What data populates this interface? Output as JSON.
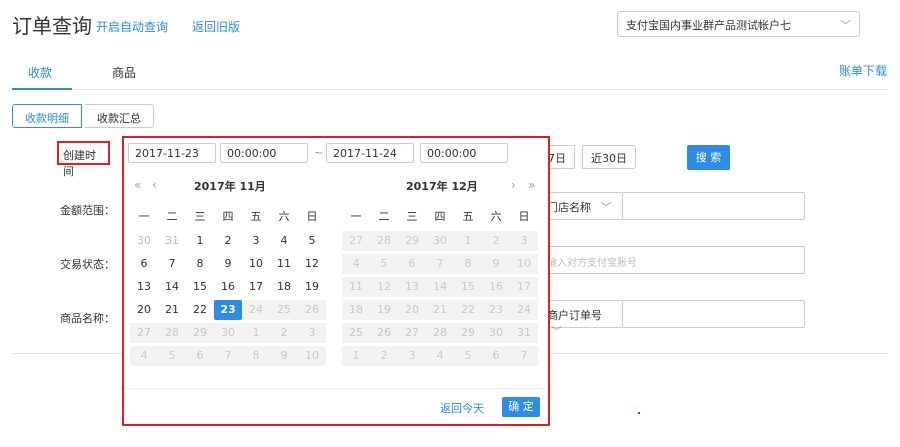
{
  "header": {
    "title": "订单查询",
    "auto_query": "开启自动查询",
    "old_version": "返回旧版",
    "account": "支付宝国内事业群产品测试帐户七"
  },
  "tabs": {
    "receipts": "收款",
    "goods": "商品",
    "bill_download": "账单下载"
  },
  "subtabs": {
    "detail": "收款明细",
    "summary": "收款汇总"
  },
  "form": {
    "created_time": "创建时间",
    "amount_range": "金额范围：",
    "trade_status": "交易状态：",
    "goods_name": "商品名称：",
    "quick_7": "7日",
    "quick_30": "近30日",
    "search": "搜 索",
    "store_name": "门店名称",
    "counterparty_placeholder": "输入对方支付宝账号",
    "merchant_order": "商户订单号"
  },
  "picker": {
    "start_date": "2017-11-23",
    "start_time": "00:00:00",
    "tilde": "~",
    "end_date": "2017-11-24",
    "end_time": "00:00:00",
    "nav_prev_year": "«",
    "nav_prev_month": "‹",
    "nav_next_month": "›",
    "nav_next_year": "»",
    "left_title": "2017年 11月",
    "right_title": "2017年 12月",
    "weekdays": [
      "一",
      "二",
      "三",
      "四",
      "五",
      "六",
      "日"
    ],
    "left_days": [
      [
        "30",
        "31",
        "1",
        "2",
        "3",
        "4",
        "5"
      ],
      [
        "6",
        "7",
        "8",
        "9",
        "10",
        "11",
        "12"
      ],
      [
        "13",
        "14",
        "15",
        "16",
        "17",
        "18",
        "19"
      ],
      [
        "20",
        "21",
        "22",
        "23",
        "24",
        "25",
        "26"
      ],
      [
        "27",
        "28",
        "29",
        "30",
        "1",
        "2",
        "3"
      ],
      [
        "4",
        "5",
        "6",
        "7",
        "8",
        "9",
        "10"
      ]
    ],
    "right_days": [
      [
        "27",
        "28",
        "29",
        "30",
        "1",
        "2",
        "3"
      ],
      [
        "4",
        "5",
        "6",
        "7",
        "8",
        "9",
        "10"
      ],
      [
        "11",
        "12",
        "13",
        "14",
        "15",
        "16",
        "17"
      ],
      [
        "18",
        "19",
        "20",
        "21",
        "22",
        "23",
        "24"
      ],
      [
        "25",
        "26",
        "27",
        "28",
        "29",
        "30",
        "31"
      ],
      [
        "1",
        "2",
        "3",
        "4",
        "5",
        "6",
        "7"
      ]
    ],
    "back_today": "返回今天",
    "confirm": "确 定"
  },
  "colors": {
    "accent": "#2d8ce6",
    "highlight": "#e02020"
  }
}
